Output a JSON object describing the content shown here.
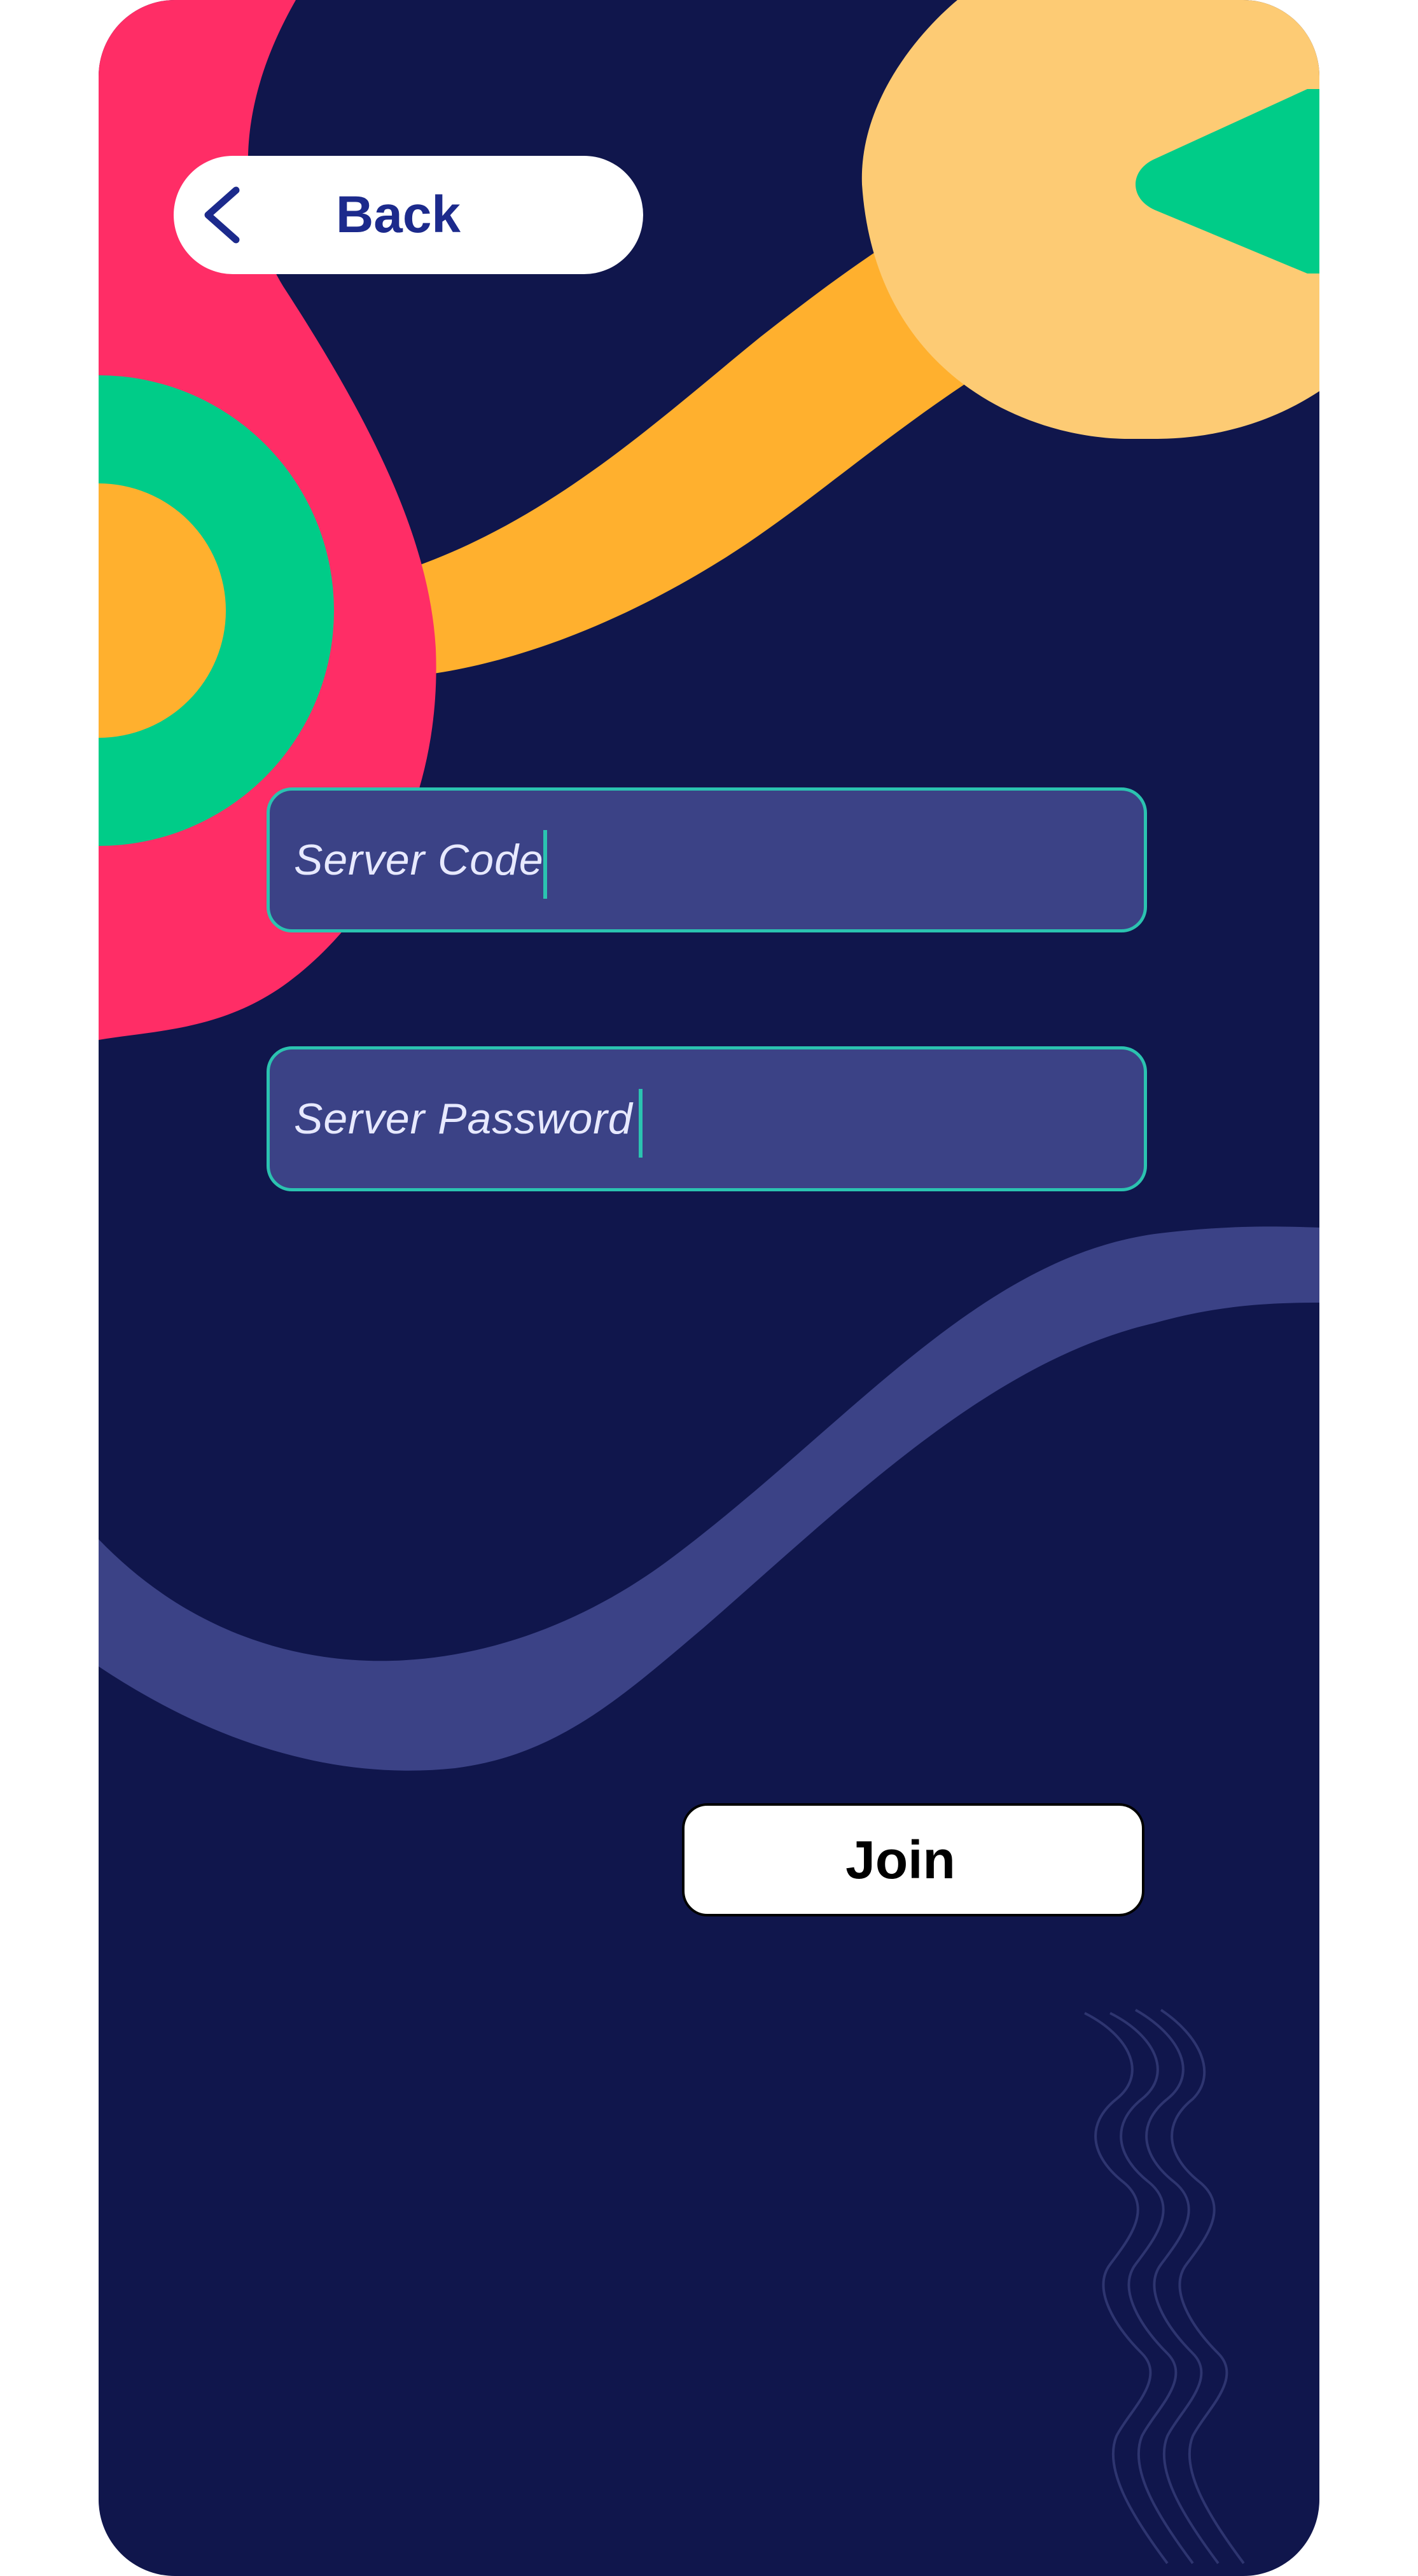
{
  "back_button": {
    "icon": "chevron-left-icon",
    "label": "Back"
  },
  "form": {
    "server_code": {
      "placeholder": "Server Code",
      "value": ""
    },
    "server_password": {
      "placeholder": "Server Password",
      "value": ""
    },
    "join_label": "Join"
  },
  "colors": {
    "background": "#10164c",
    "pink": "#ff2d66",
    "green": "#00cc88",
    "orange": "#ffb02e",
    "peach": "#fdcb74",
    "field_fill": "#3b4286",
    "field_border": "#2bc3b0",
    "back_text": "#1c2a8c"
  }
}
